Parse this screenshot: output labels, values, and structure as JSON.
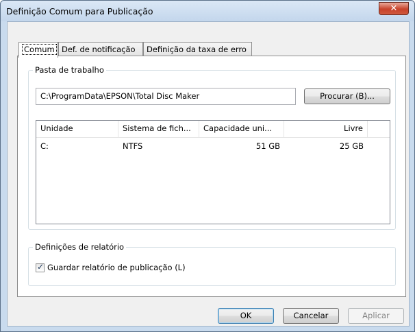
{
  "window": {
    "title": "Definição Comum para Publicação",
    "close_glyph": "✕"
  },
  "tabs": [
    {
      "label": "Comum",
      "active": true
    },
    {
      "label": "Def. de notificação",
      "active": false
    },
    {
      "label": "Definição da taxa de erro",
      "active": false
    }
  ],
  "working_folder": {
    "group_label": "Pasta de trabalho",
    "path": "C:\\ProgramData\\EPSON\\Total Disc Maker",
    "browse_button": "Procurar (B)..."
  },
  "drives_table": {
    "columns": [
      "Unidade",
      "Sistema de fich...",
      "Capacidade uni...",
      "Livre"
    ],
    "rows": [
      [
        "C:",
        "NTFS",
        "51 GB",
        "25 GB"
      ]
    ]
  },
  "report": {
    "group_label": "Definições de relatório",
    "save_report_label": "Guardar relatório de publicação (L)",
    "save_report_checked": true
  },
  "buttons": {
    "ok": "OK",
    "cancel": "Cancelar",
    "apply": "Aplicar"
  }
}
